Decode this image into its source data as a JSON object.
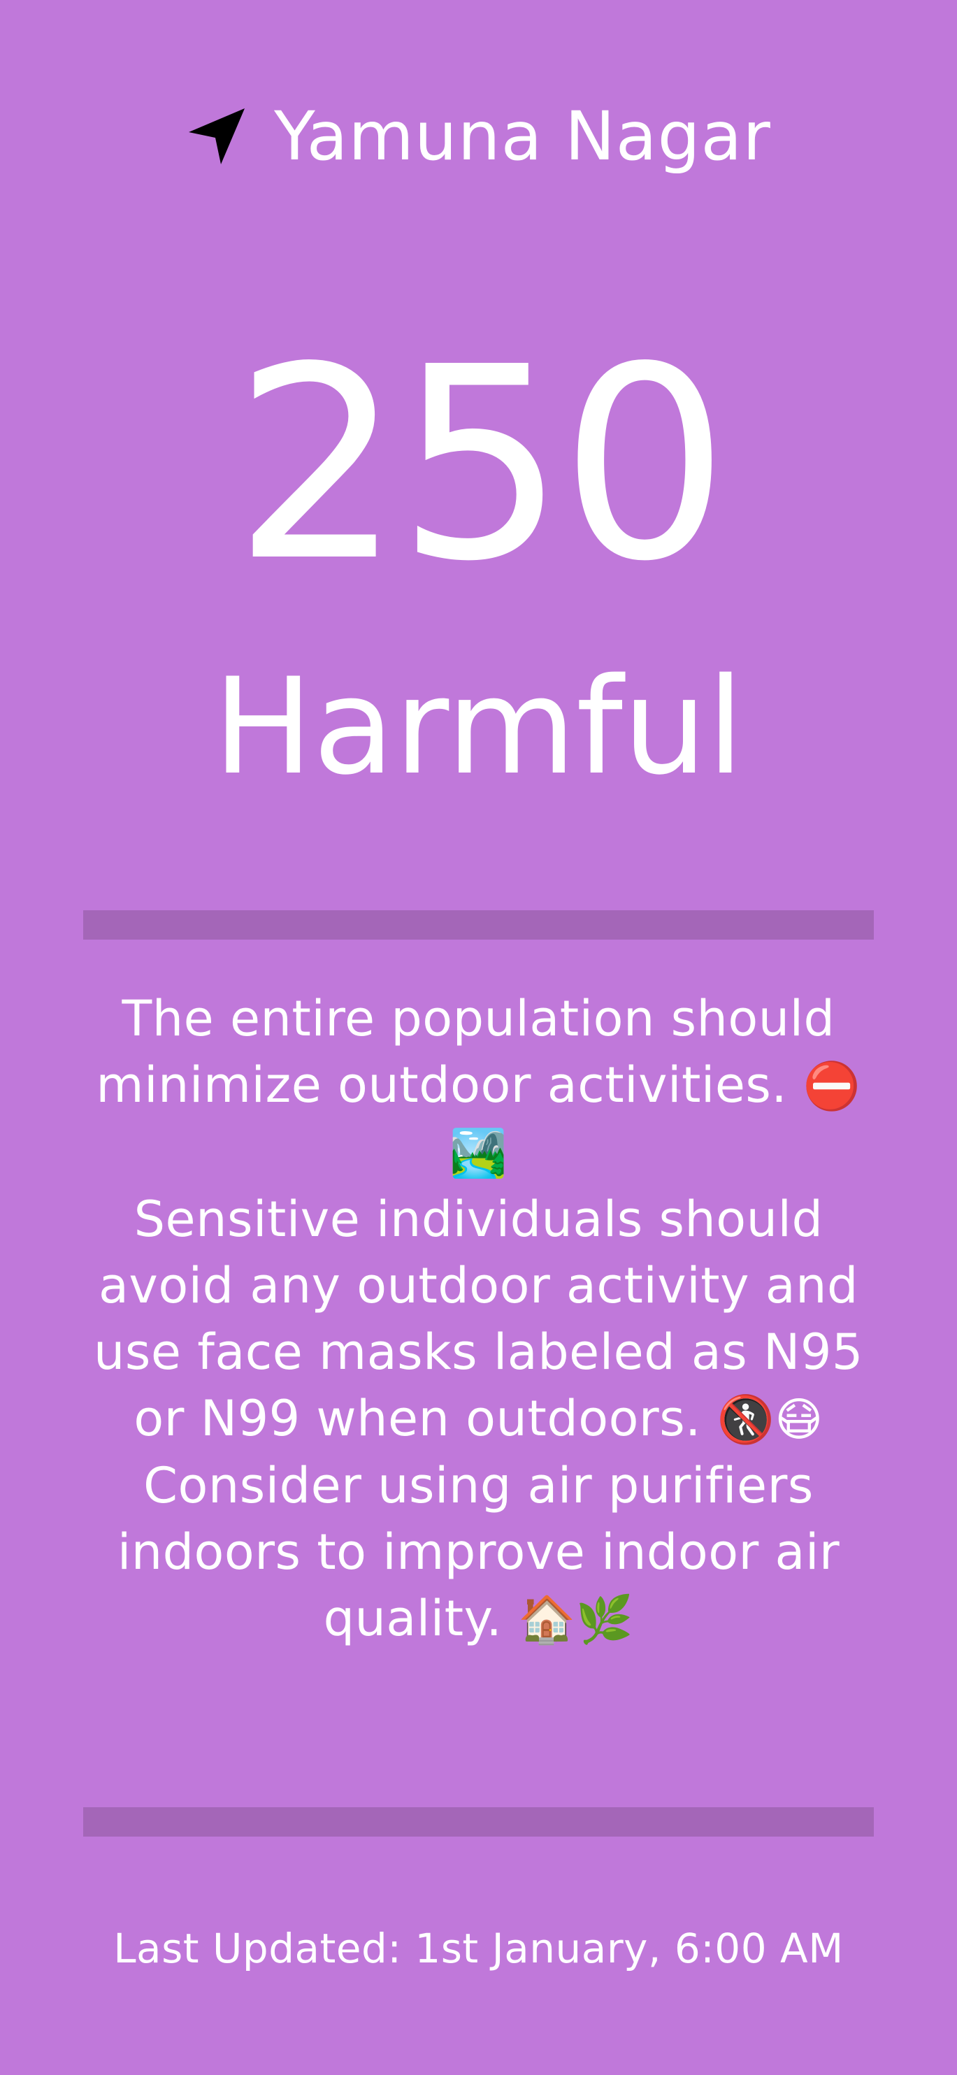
{
  "location": {
    "icon": "navigation-arrow-icon",
    "name": "Yamuna Nagar"
  },
  "aqi": {
    "value": "250",
    "category": "Harmful"
  },
  "advice": {
    "line1_text": "The entire population should minimize outdoor activities. ",
    "line1_emoji": "⛔🏞️",
    "line2_text": "Sensitive individuals should avoid any outdoor activity and use face masks labeled as N95 or N99 when outdoors. ",
    "line2_emoji": "🚷😷",
    "line3_text": "Consider using air purifiers indoors to improve indoor air quality. ",
    "line3_emoji": "🏠🌿"
  },
  "footer": {
    "last_updated": "Last Updated: 1st January, 6:00 AM"
  },
  "colors": {
    "background": "#c078da",
    "divider": "#a466b8",
    "text": "#ffffff"
  }
}
